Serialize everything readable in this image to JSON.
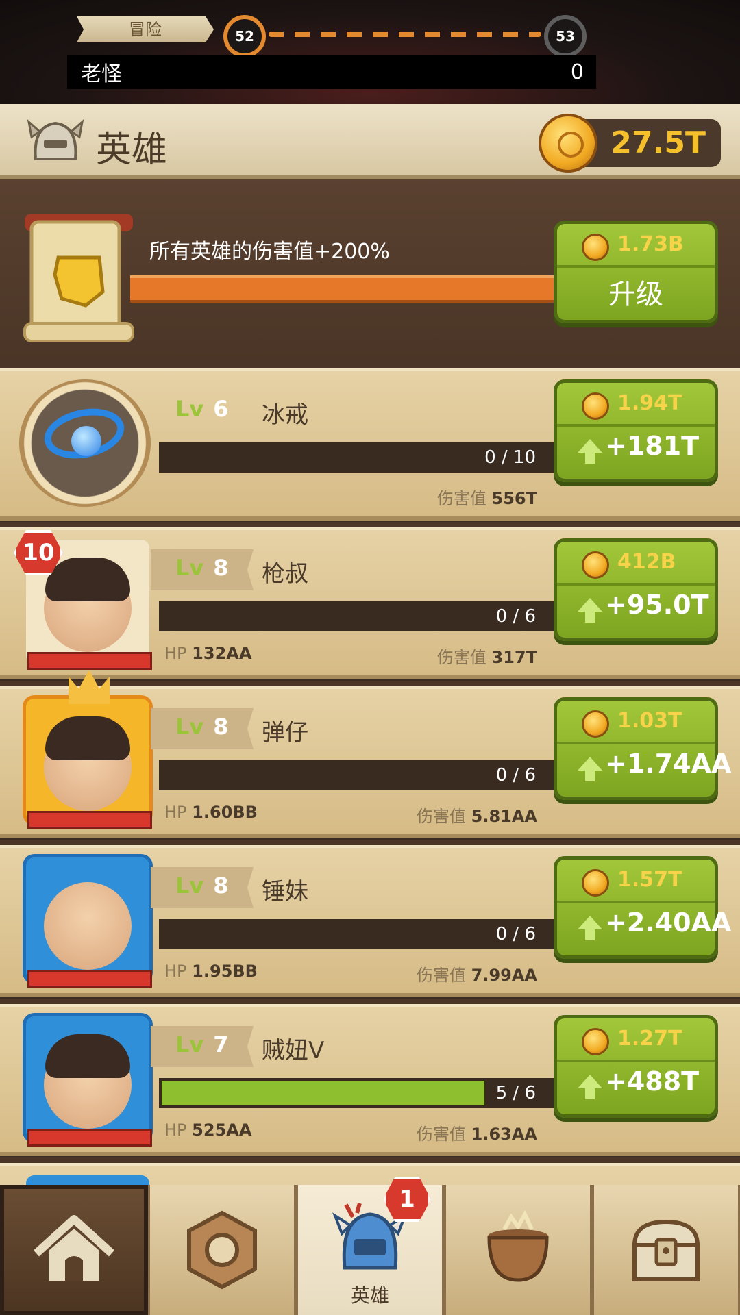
{
  "stage": {
    "ribbon_label": "冒险",
    "current_level": "52",
    "next_level": "53",
    "boss_name": "老怪",
    "boss_value": "0"
  },
  "header": {
    "title": "英雄",
    "gold": "27.5T"
  },
  "global_upgrade": {
    "description": "所有英雄的伤害值+200%",
    "cost": "1.73B",
    "button_label": "升级"
  },
  "heroes": [
    {
      "level_prefix": "Lv",
      "level": "6",
      "name": "冰戒",
      "progress": "0 / 10",
      "progress_fraction": 0.0,
      "hp_label": "",
      "hp": "",
      "damage_label": "伤害值",
      "damage": "556T",
      "cost": "1.94T",
      "gain": "+181T",
      "type": "ring"
    },
    {
      "level_prefix": "Lv",
      "level": "8",
      "name": "枪叔",
      "progress": "0 / 6",
      "progress_fraction": 0.0,
      "hp_label": "HP",
      "hp": "132AA",
      "damage_label": "伤害值",
      "damage": "317T",
      "cost": "412B",
      "gain": "+95.0T",
      "badge": "10",
      "frame_color": "#f3e6c6"
    },
    {
      "level_prefix": "Lv",
      "level": "8",
      "name": "弹仔",
      "progress": "0 / 6",
      "progress_fraction": 0.0,
      "hp_label": "HP",
      "hp": "1.60BB",
      "damage_label": "伤害值",
      "damage": "5.81AA",
      "cost": "1.03T",
      "gain": "+1.74AA",
      "frame_color": "#f5b62a"
    },
    {
      "level_prefix": "Lv",
      "level": "8",
      "name": "锤妹",
      "progress": "0 / 6",
      "progress_fraction": 0.0,
      "hp_label": "HP",
      "hp": "1.95BB",
      "damage_label": "伤害值",
      "damage": "7.99AA",
      "cost": "1.57T",
      "gain": "+2.40AA",
      "frame_color": "#2f8fd8"
    },
    {
      "level_prefix": "Lv",
      "level": "7",
      "name": "贼妞V",
      "progress": "5 / 6",
      "progress_fraction": 0.83,
      "hp_label": "HP",
      "hp": "525AA",
      "damage_label": "伤害值",
      "damage": "1.63AA",
      "cost": "1.27T",
      "gain": "+488T",
      "frame_color": "#2f8fd8"
    }
  ],
  "nav": {
    "tabs": [
      {
        "icon": "camp-icon",
        "label": ""
      },
      {
        "icon": "ring-icon",
        "label": ""
      },
      {
        "icon": "helmet-icon",
        "label": "英雄",
        "badge": "1"
      },
      {
        "icon": "cauldron-icon",
        "label": ""
      },
      {
        "icon": "chest-icon",
        "label": ""
      }
    ]
  },
  "colors": {
    "accent_green": "#8fb52a",
    "gold_text": "#f6c02d",
    "badge_red": "#d7392c",
    "xp_fill": "#8ebf2e"
  }
}
